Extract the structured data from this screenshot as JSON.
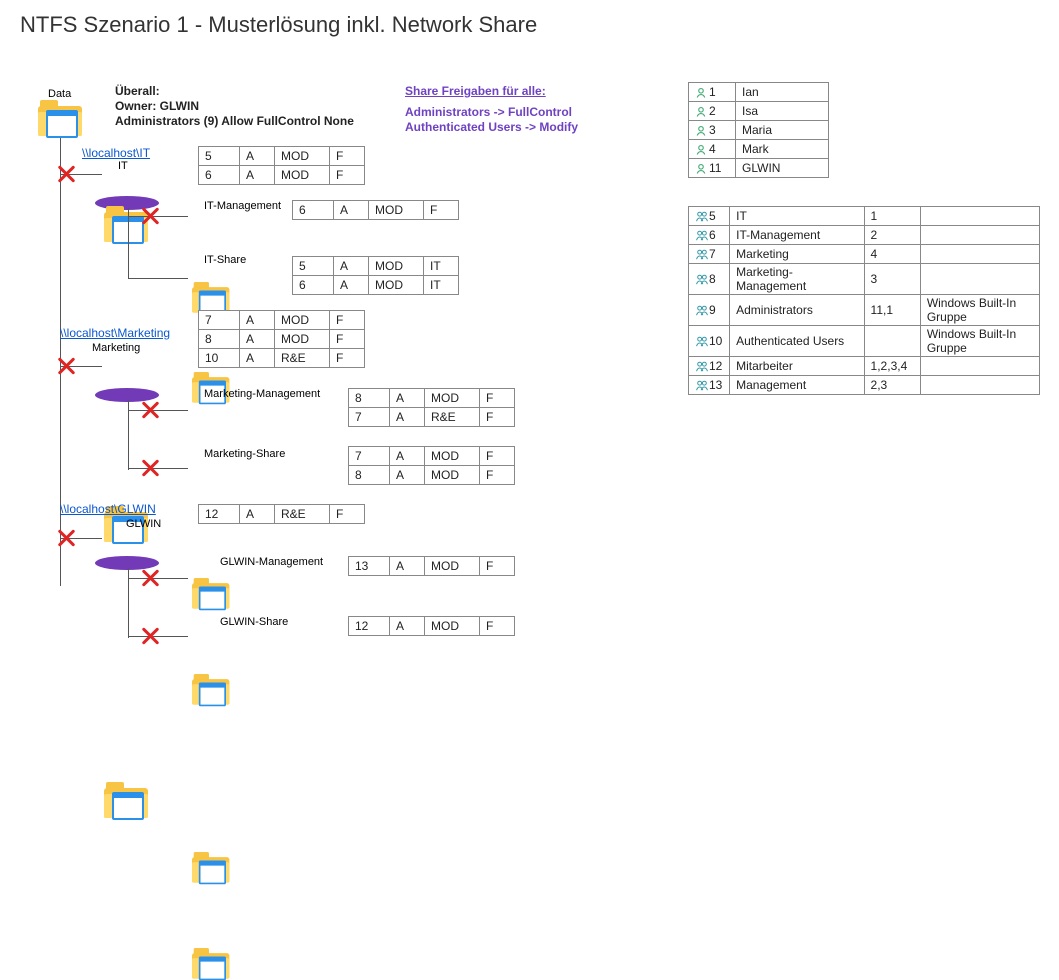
{
  "title": "NTFS Szenario 1 - Musterlösung inkl. Network Share",
  "header": {
    "uberall": "Überall:",
    "owner": "Owner: GLWIN",
    "admins": "Administrators (9) Allow FullControl None",
    "share_title": "Share Freigaben für alle:",
    "share_line1": "Administrators -> FullControl",
    "share_line2": "Authenticated Users -> Modify"
  },
  "root_label": "Data",
  "folders": {
    "it": {
      "share": "\\\\localhost\\IT",
      "label": "IT",
      "perm": [
        [
          "5",
          "A",
          "MOD",
          "F"
        ],
        [
          "6",
          "A",
          "MOD",
          "F"
        ]
      ],
      "children": {
        "mgmt": {
          "label": "IT-Management",
          "perm": [
            [
              "6",
              "A",
              "MOD",
              "F"
            ]
          ]
        },
        "share": {
          "label": "IT-Share",
          "perm": [
            [
              "5",
              "A",
              "MOD",
              "IT"
            ],
            [
              "6",
              "A",
              "MOD",
              "IT"
            ]
          ]
        }
      }
    },
    "mkt": {
      "share": "\\\\localhost\\Marketing",
      "label": "Marketing",
      "perm": [
        [
          "7",
          "A",
          "MOD",
          "F"
        ],
        [
          "8",
          "A",
          "MOD",
          "F"
        ],
        [
          "10",
          "A",
          "R&E",
          "F"
        ]
      ],
      "children": {
        "mgmt": {
          "label": "Marketing-Management",
          "perm": [
            [
              "8",
              "A",
              "MOD",
              "F"
            ],
            [
              "7",
              "A",
              "R&E",
              "F"
            ]
          ]
        },
        "share": {
          "label": "Marketing-Share",
          "perm": [
            [
              "7",
              "A",
              "MOD",
              "F"
            ],
            [
              "8",
              "A",
              "MOD",
              "F"
            ]
          ]
        }
      }
    },
    "glw": {
      "share": "\\\\localhost\\GLWIN",
      "label": "GLWIN",
      "perm": [
        [
          "12",
          "A",
          "R&E",
          "F"
        ]
      ],
      "children": {
        "mgmt": {
          "label": "GLWIN-Management",
          "perm": [
            [
              "13",
              "A",
              "MOD",
              "F"
            ]
          ]
        },
        "share": {
          "label": "GLWIN-Share",
          "perm": [
            [
              "12",
              "A",
              "MOD",
              "F"
            ]
          ]
        }
      }
    }
  },
  "users": [
    {
      "id": "1",
      "name": "Ian"
    },
    {
      "id": "2",
      "name": "Isa"
    },
    {
      "id": "3",
      "name": "Maria"
    },
    {
      "id": "4",
      "name": "Mark"
    },
    {
      "id": "11",
      "name": "GLWIN"
    }
  ],
  "groups": [
    {
      "id": "5",
      "name": "IT",
      "members": "1",
      "note": ""
    },
    {
      "id": "6",
      "name": "IT-Management",
      "members": "2",
      "note": ""
    },
    {
      "id": "7",
      "name": "Marketing",
      "members": "4",
      "note": ""
    },
    {
      "id": "8",
      "name": "Marketing-Management",
      "members": "3",
      "note": ""
    },
    {
      "id": "9",
      "name": "Administrators",
      "members": "11,1",
      "note": "Windows Built-In Gruppe"
    },
    {
      "id": "10",
      "name": "Authenticated Users",
      "members": "",
      "note": "Windows Built-In Gruppe"
    },
    {
      "id": "12",
      "name": "Mitarbeiter",
      "members": "1,2,3,4",
      "note": ""
    },
    {
      "id": "13",
      "name": "Management",
      "members": "2,3",
      "note": ""
    }
  ]
}
